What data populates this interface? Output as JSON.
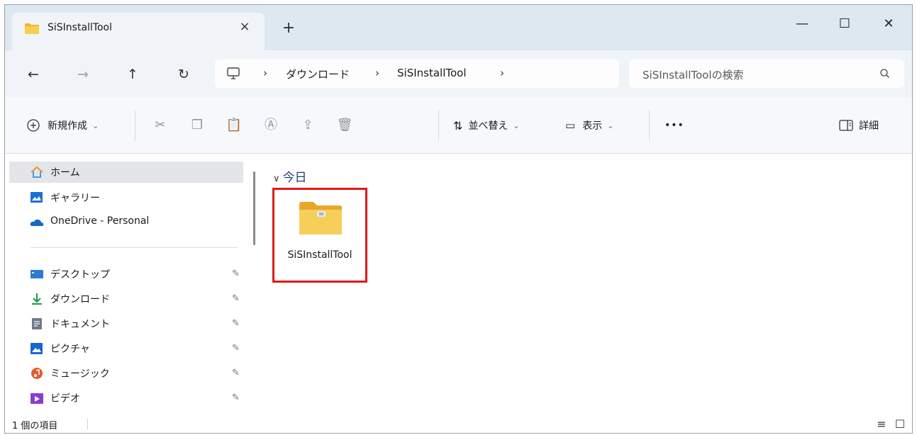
{
  "window": {
    "tab_title": "SiSInstallTool",
    "tab_close": "×",
    "new_tab": "+",
    "minimize": "—",
    "maximize": "☐",
    "close": "✕"
  },
  "nav": {
    "back": "←",
    "forward": "→",
    "up": "↑",
    "refresh": "↻"
  },
  "address": {
    "crumbs": [
      "ダウンロード",
      "SiSInstallTool"
    ],
    "separator": "›"
  },
  "search": {
    "placeholder": "SiSInstallToolの検索"
  },
  "toolbar": {
    "new_label": "新規作成",
    "sort_label": "並べ替え",
    "view_label": "表示",
    "more_label": "•••",
    "details_label": "詳細"
  },
  "sidebar": {
    "items": [
      {
        "label": "ホーム",
        "icon": "home-icon",
        "selected": true
      },
      {
        "label": "ギャラリー",
        "icon": "gallery-icon"
      },
      {
        "label": "OneDrive - Personal",
        "icon": "onedrive-icon"
      },
      {
        "label": "デスクトップ",
        "icon": "desktop-icon",
        "pinned": true
      },
      {
        "label": "ダウンロード",
        "icon": "download-icon",
        "pinned": true
      },
      {
        "label": "ドキュメント",
        "icon": "documents-icon",
        "pinned": true
      },
      {
        "label": "ピクチャ",
        "icon": "pictures-icon",
        "pinned": true
      },
      {
        "label": "ミュージック",
        "icon": "music-icon",
        "pinned": true
      },
      {
        "label": "ビデオ",
        "icon": "videos-icon",
        "pinned": true
      }
    ]
  },
  "content": {
    "group_header": "今日",
    "items": [
      {
        "name": "SiSInstallTool",
        "type": "folder",
        "highlighted": true
      }
    ]
  },
  "status": {
    "item_count": "1 個の項目"
  },
  "colors": {
    "accent_tab": "#dde8f1",
    "highlight_border": "#e01a1a",
    "folder_yellow": "#f4c84a"
  }
}
